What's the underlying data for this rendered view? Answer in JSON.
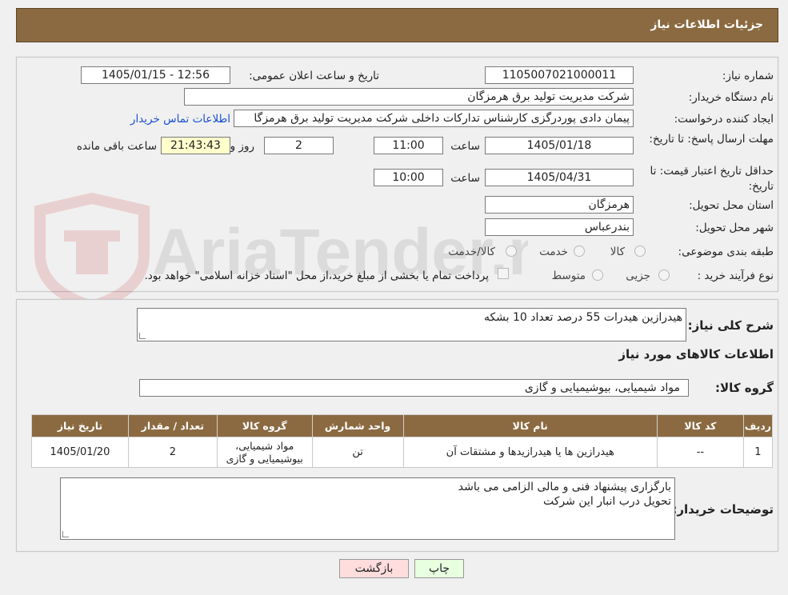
{
  "header": {
    "title": "جزئیات اطلاعات نیاز"
  },
  "watermark": {
    "text": "AriaTender.neT"
  },
  "form": {
    "need_number_label": "شماره نیاز:",
    "need_number": "1105007021000011",
    "announce_label": "تاریخ و ساعت اعلان عمومی:",
    "announce_value": "1405/01/15 - 12:56",
    "buyer_org_label": "نام دستگاه خریدار:",
    "buyer_org": "شرکت مدیریت تولید برق هرمزگان",
    "creator_label": "ایجاد کننده درخواست:",
    "creator": "پیمان دادی پوردرگزی کارشناس تدارکات داخلی شرکت مدیریت تولید برق هرمزگا",
    "contact_link": "اطلاعات تماس خریدار",
    "deadline_label": "مهلت ارسال پاسخ: تا تاریخ:",
    "deadline_date": "1405/01/18",
    "time_label": "ساعت",
    "deadline_time": "11:00",
    "days_value": "2",
    "days_label": "روز و",
    "remaining_time": "21:43:43",
    "remaining_label": "ساعت باقی مانده",
    "validity_label": "حداقل تاریخ اعتبار قیمت: تا تاریخ:",
    "validity_date": "1405/04/31",
    "validity_time": "10:00",
    "province_label": "استان محل تحویل:",
    "province": "هرمزگان",
    "city_label": "شهر محل تحویل:",
    "city": "بندرعباس",
    "category_label": "طبقه بندی موضوعی:",
    "category_options": [
      "کالا",
      "خدمت",
      "کالا/خدمت"
    ],
    "process_label": "نوع فرآیند خرید :",
    "process_options": [
      "جزیی",
      "متوسط"
    ],
    "payment_note": "پرداخت تمام یا بخشی از مبلغ خرید،از محل \"اسناد خزانه اسلامی\" خواهد بود."
  },
  "details": {
    "summary_label": "شرح کلی نیاز:",
    "summary": "هیدرازین هیدرات 55 درصد تعداد 10 بشکه",
    "goods_info_title": "اطلاعات کالاهای مورد نیاز",
    "goods_group_label": "گروه کالا:",
    "goods_group": "مواد شیمیایی، بیوشیمیایی و  گازی",
    "table": {
      "headers": [
        "ردیف",
        "کد کالا",
        "نام کالا",
        "واحد شمارش",
        "گروه کالا",
        "تعداد / مقدار",
        "تاریخ نیاز"
      ],
      "rows": [
        [
          "1",
          "--",
          "هیدرازین ها یا هیدرازیدها و مشتقات آن",
          "تن",
          "مواد شیمیایی، بیوشیمیایی و گازی",
          "2",
          "1405/01/20"
        ]
      ]
    },
    "buyer_notes_label": "توضیحات خریدار:",
    "buyer_notes_line1": "بارگزاری پیشنهاد فنی و مالی الزامی می باشد",
    "buyer_notes_line2": "تحویل درب انبار این شرکت"
  },
  "buttons": {
    "print": "چاپ",
    "back": "بازگشت"
  },
  "colors": {
    "header_bg": "#8b6a41",
    "link": "#1a4fd0",
    "remaining_bg": "#ffffcc",
    "back_btn_bg": "#ffdddd",
    "print_btn_bg": "#e8ffe0"
  }
}
